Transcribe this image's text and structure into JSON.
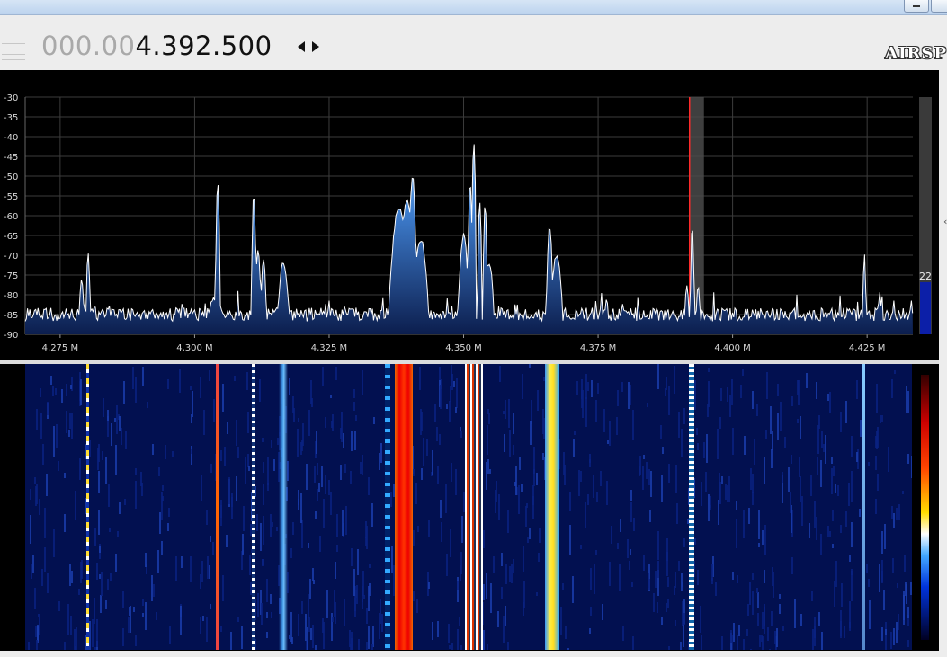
{
  "window": {
    "logo": "AIRSP"
  },
  "frequency": {
    "dim_digits": "000.00",
    "bright_digits": "4.392.500"
  },
  "spectrum": {
    "y_ticks": [
      "-30",
      "-35",
      "-40",
      "-45",
      "-50",
      "-55",
      "-60",
      "-65",
      "-70",
      "-75",
      "-80",
      "-85",
      "-90"
    ],
    "y_range": [
      -90,
      -30
    ],
    "x_ticks": [
      "4,275 M",
      "4,300 M",
      "4,325 M",
      "4,350 M",
      "4,375 M",
      "4,400 M",
      "4,425 M"
    ],
    "x_tick_values": [
      4275,
      4300,
      4325,
      4350,
      4375,
      4400,
      4425
    ],
    "x_range": [
      4268.5,
      4433.5
    ],
    "noise_floor": -85,
    "peaks": [
      {
        "f": 4279.0,
        "db": -76,
        "w": 0.5
      },
      {
        "f": 4280.2,
        "db": -69,
        "w": 0.35
      },
      {
        "f": 4303.5,
        "db": -81,
        "w": 1.5
      },
      {
        "f": 4304.3,
        "db": -52,
        "w": 0.3
      },
      {
        "f": 4311.0,
        "db": -54,
        "w": 0.3
      },
      {
        "f": 4311.8,
        "db": -69,
        "w": 0.5
      },
      {
        "f": 4312.8,
        "db": -71,
        "w": 0.5
      },
      {
        "f": 4316.5,
        "db": -72,
        "w": 1.0
      },
      {
        "f": 4338.0,
        "db": -58,
        "w": 1.3
      },
      {
        "f": 4339.5,
        "db": -56,
        "w": 1.0
      },
      {
        "f": 4340.5,
        "db": -50,
        "w": 0.5
      },
      {
        "f": 4342.0,
        "db": -66,
        "w": 1.2
      },
      {
        "f": 4350.0,
        "db": -65,
        "w": 0.8
      },
      {
        "f": 4351.2,
        "db": -51,
        "w": 0.3
      },
      {
        "f": 4351.9,
        "db": -42,
        "w": 0.3
      },
      {
        "f": 4353.0,
        "db": -56,
        "w": 0.3
      },
      {
        "f": 4354.0,
        "db": -57,
        "w": 0.3
      },
      {
        "f": 4354.8,
        "db": -72,
        "w": 0.8
      },
      {
        "f": 4366.0,
        "db": -63,
        "w": 0.5
      },
      {
        "f": 4367.3,
        "db": -70,
        "w": 1.0
      },
      {
        "f": 4391.5,
        "db": -78,
        "w": 0.5
      },
      {
        "f": 4392.5,
        "db": -63,
        "w": 0.3
      },
      {
        "f": 4393.6,
        "db": -78,
        "w": 0.5
      },
      {
        "f": 4424.5,
        "db": -70,
        "w": 0.3
      },
      {
        "f": 4427.3,
        "db": -79,
        "w": 0.3
      }
    ],
    "vfo_frequency": 4392.5,
    "gain_value": "22",
    "gain_level": 0.22
  },
  "colors": {
    "accent": "#3f7fd0",
    "vfo_line": "#ff2a2a",
    "trace": "#ffffff"
  }
}
